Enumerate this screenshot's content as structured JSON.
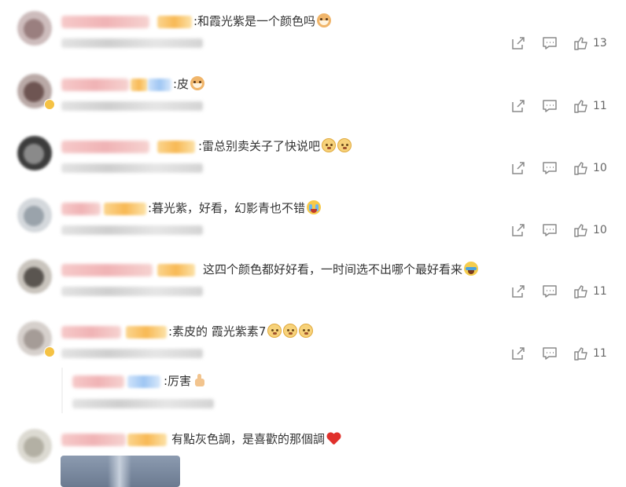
{
  "comments": [
    {
      "text": ":和霞光紫是一个颜色吗",
      "emojis": [
        "cat"
      ],
      "like_count": "13"
    },
    {
      "text": ":皮",
      "emojis": [
        "cat"
      ],
      "like_count": "11"
    },
    {
      "text": ":雷总别卖关子了快说吧",
      "emojis": [
        "dog",
        "dog"
      ],
      "like_count": "10"
    },
    {
      "text": ":暮光紫，好看，幻影青也不错",
      "emojis": [
        "cry"
      ],
      "like_count": "10"
    },
    {
      "text": "这四个颜色都好好看，一时间选不出哪个最好看来",
      "emojis": [
        "laugh"
      ],
      "like_count": "11"
    },
    {
      "text": ":素皮的 霞光紫素7",
      "emojis": [
        "dog",
        "dog",
        "dog"
      ],
      "like_count": "11"
    },
    {
      "text": "有點灰色調，是喜歡的那個調",
      "emojis": [
        "heart"
      ]
    }
  ],
  "sub_reply": {
    "text": ":厉害",
    "emojis": [
      "thumbs-up"
    ]
  },
  "icons": {
    "share": "share-icon",
    "reply": "comment-icon",
    "like": "thumbs-up-icon"
  },
  "colors": {
    "icon": "#8a8a8a",
    "text": "#333333",
    "count": "#666666"
  }
}
